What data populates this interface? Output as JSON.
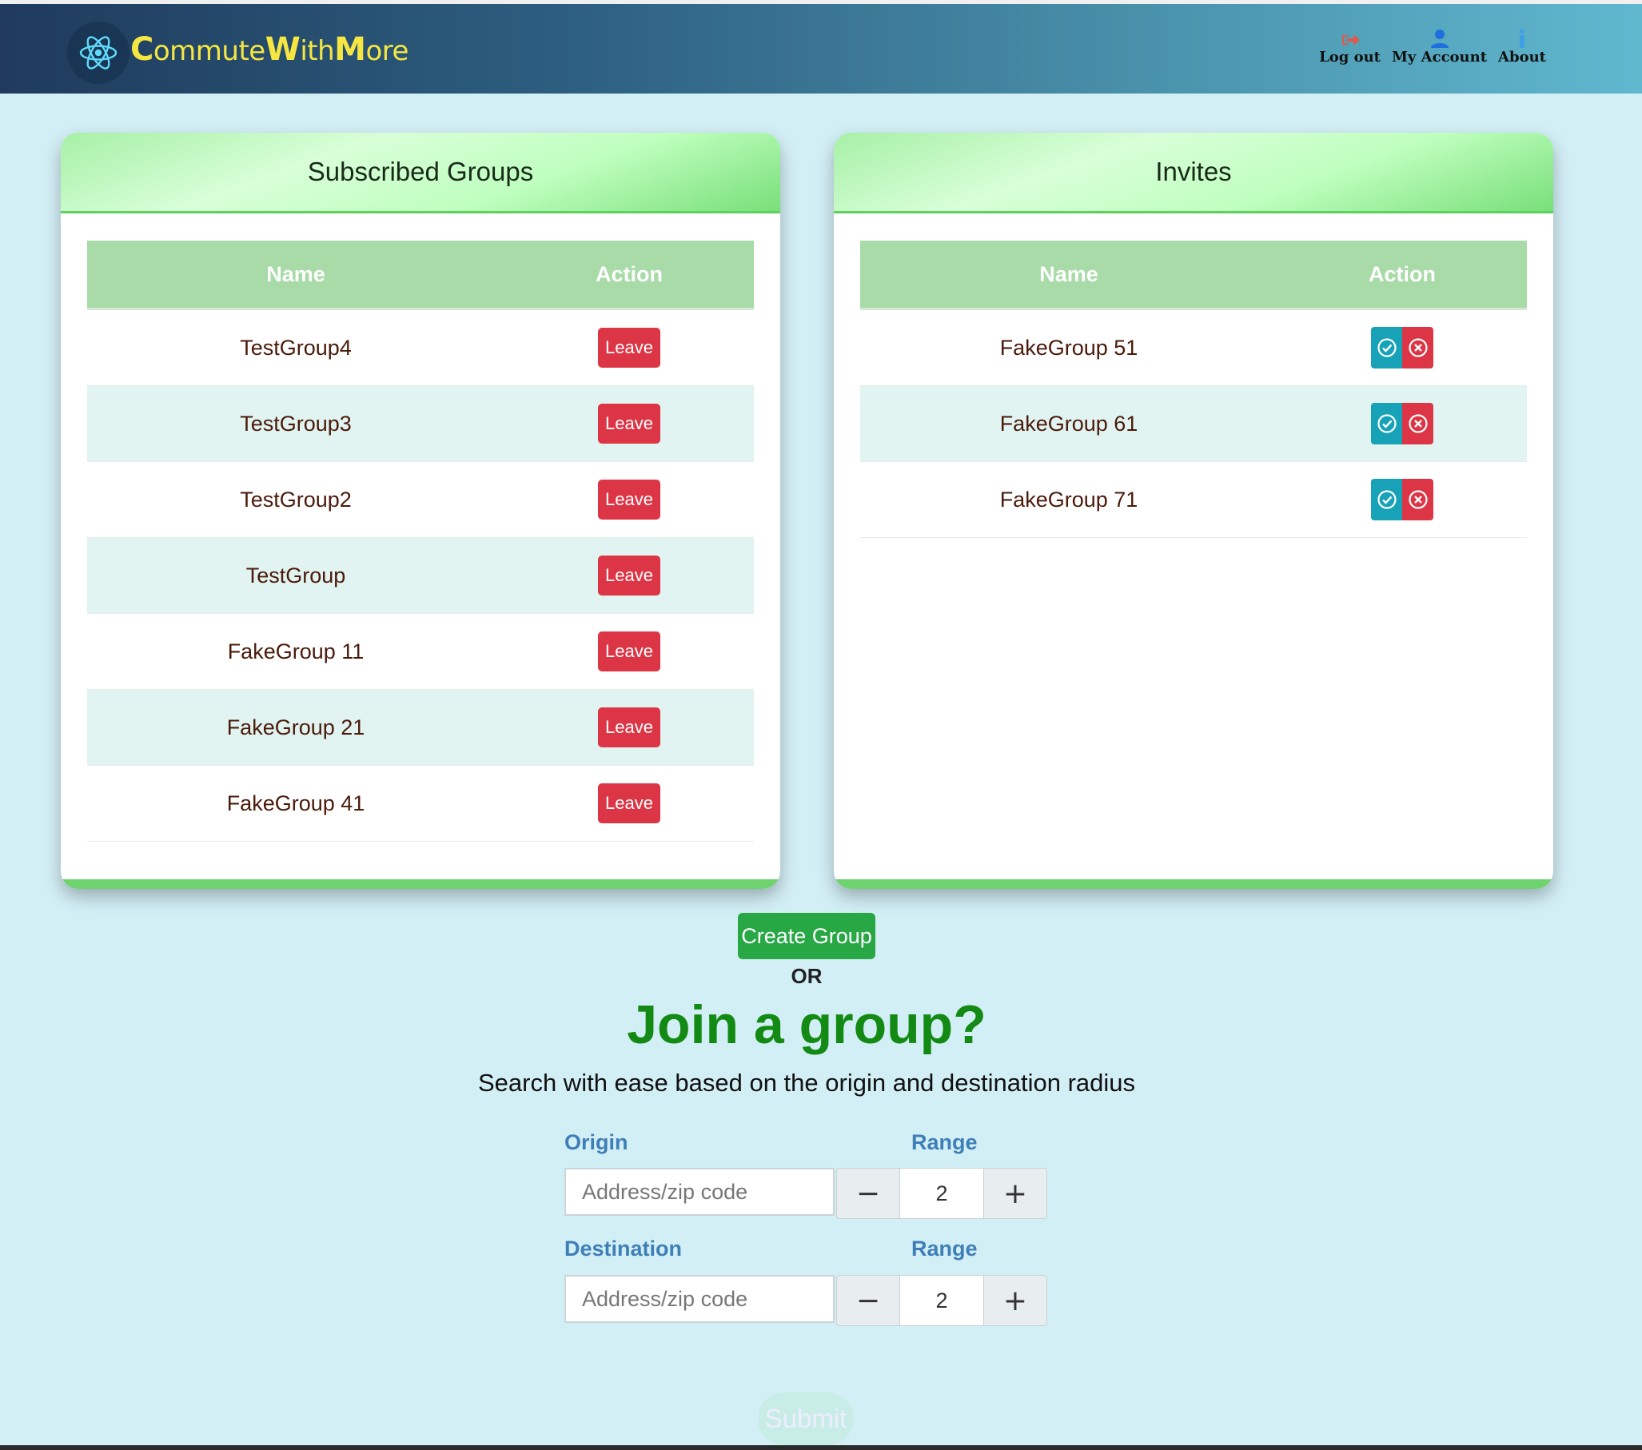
{
  "app": {
    "brand": {
      "c1": "C",
      "r1": "ommute",
      "c2": "W",
      "r2": "ith",
      "c3": "M",
      "r3": "ore"
    },
    "nav": [
      {
        "label": "Log out",
        "icon": "logout-icon"
      },
      {
        "label": "My Account",
        "icon": "user-icon"
      },
      {
        "label": "About",
        "icon": "info-icon"
      }
    ]
  },
  "subscribed": {
    "title": "Subscribed Groups",
    "col_name": "Name",
    "col_action": "Action",
    "leave_label": "Leave",
    "rows": [
      "TestGroup4",
      "TestGroup3",
      "TestGroup2",
      "TestGroup",
      "FakeGroup 11",
      "FakeGroup 21",
      "FakeGroup 41"
    ]
  },
  "invites": {
    "title": "Invites",
    "col_name": "Name",
    "col_action": "Action",
    "rows": [
      "FakeGroup 51",
      "FakeGroup 61",
      "FakeGroup 71"
    ]
  },
  "join": {
    "create_label": "Create Group",
    "or_label": "OR",
    "heading": "Join a group?",
    "subheading": "Search with ease based on the origin and destination radius",
    "origin_label": "Origin",
    "destination_label": "Destination",
    "range_label": "Range",
    "placeholder": "Address/zip code",
    "origin_range": "2",
    "destination_range": "2",
    "minus": "−",
    "plus": "+",
    "submit_label": "Submit"
  },
  "colors": {
    "accent_green": "#28a745",
    "leave_red": "#dc3545",
    "accept_teal": "#17a2b8",
    "brand_yellow": "#f5e642"
  }
}
